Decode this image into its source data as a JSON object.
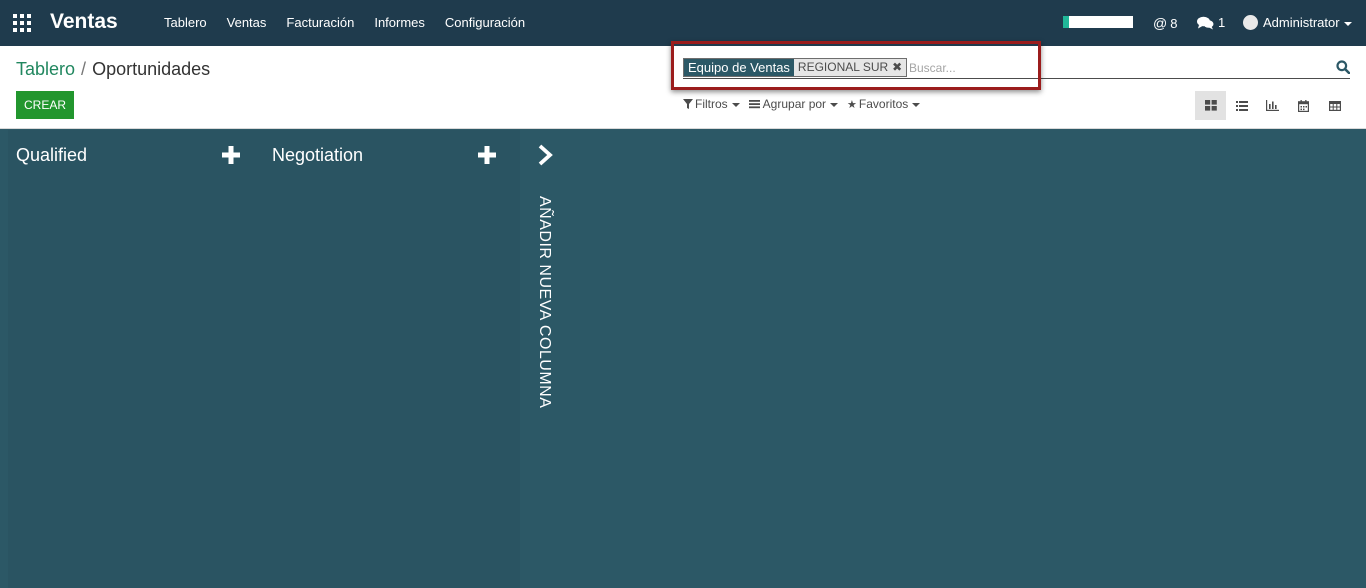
{
  "navbar": {
    "app_name": "Ventas",
    "menu": [
      "Tablero",
      "Ventas",
      "Facturación",
      "Informes",
      "Configuración"
    ],
    "progress": 0.08,
    "mentions_count": "8",
    "messages_count": "1",
    "user": "Administrator",
    "icons": [
      "apps-grid-icon",
      "at-icon",
      "comments-icon",
      "avatar"
    ]
  },
  "breadcrumb": {
    "parent": "Tablero",
    "separator": "/",
    "current": "Oportunidades"
  },
  "create_label": "CREAR",
  "search": {
    "facet_label": "Equipo de Ventas",
    "facet_value": "REGIONAL SUR",
    "facet_remove": "✖",
    "placeholder": "Buscar..."
  },
  "filters": {
    "filters_label": "Filtros",
    "groupby_label": "Agrupar por",
    "favorites_label": "Favoritos"
  },
  "views": [
    "kanban",
    "list",
    "graph",
    "calendar",
    "pivot"
  ],
  "kanban": {
    "columns": [
      {
        "title": "Qualified"
      },
      {
        "title": "Negotiation"
      }
    ],
    "add_column_label": "AÑADIR NUEVA COLUMNA"
  },
  "colors": {
    "navbar": "#1f3b4d",
    "kanban_bg": "#2c5866",
    "primary_button": "#22962e",
    "breadcrumb_link": "#21875f",
    "highlight": "#9b1c1c"
  }
}
